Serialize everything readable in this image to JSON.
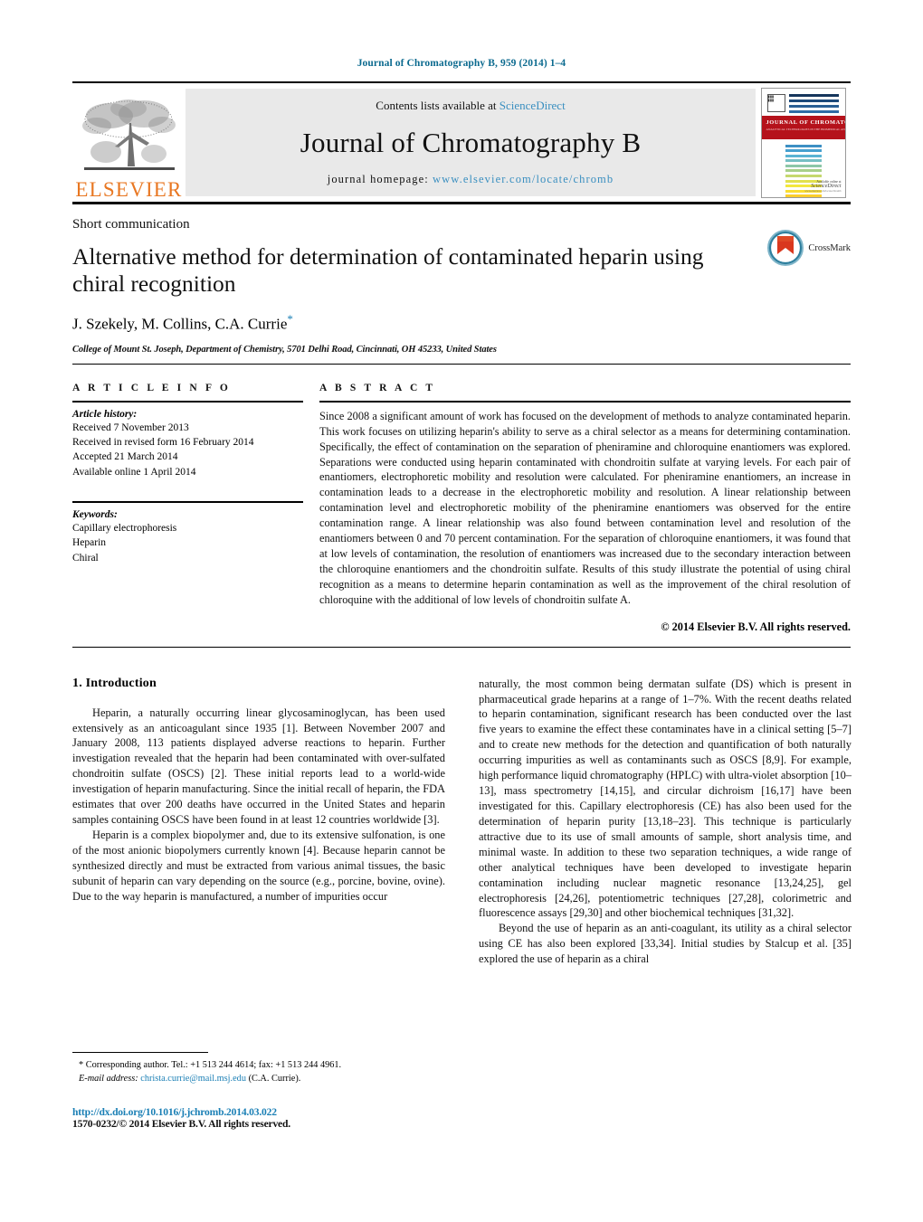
{
  "running_head": "Journal of Chromatography B, 959 (2014) 1–4",
  "masthead": {
    "publisher_name": "ELSEVIER",
    "contents_prefix": "Contents lists available at ",
    "contents_link": "ScienceDirect",
    "journal_title": "Journal of Chromatography B",
    "homepage_prefix": "journal homepage: ",
    "homepage_url": "www.elsevier.com/locate/chromb",
    "cover": {
      "banner_title": "JOURNAL OF CHROMATOGRAPHY B",
      "banner_sub": "ANALYTICAL TECHNOLOGIES IN THE BIOMEDICAL AND LIFE SCIENCES",
      "foot_small": "Available online at",
      "foot_brand": "ScienceDirect",
      "foot_url": "www.elsevier.com/locate/chromb"
    }
  },
  "article": {
    "doctype": "Short communication",
    "title": "Alternative method for determination of contaminated heparin using chiral recognition",
    "authors": "J. Szekely, M. Collins, C.A. Currie",
    "author_star": "*",
    "affiliation": "College of Mount St. Joseph, Department of Chemistry, 5701 Delhi Road, Cincinnati, OH 45233, United States",
    "crossmark_label": "CrossMark"
  },
  "article_info": {
    "section_label": "A R T I C L E   I N F O",
    "history_title": "Article history:",
    "history": [
      "Received 7 November 2013",
      "Received in revised form 16 February 2014",
      "Accepted 21 March 2014",
      "Available online 1 April 2014"
    ],
    "keywords_title": "Keywords:",
    "keywords": [
      "Capillary electrophoresis",
      "Heparin",
      "Chiral"
    ]
  },
  "abstract": {
    "section_label": "A B S T R A C T",
    "text": "Since 2008 a significant amount of work has focused on the development of methods to analyze contaminated heparin. This work focuses on utilizing heparin's ability to serve as a chiral selector as a means for determining contamination. Specifically, the effect of contamination on the separation of pheniramine and chloroquine enantiomers was explored. Separations were conducted using heparin contaminated with chondroitin sulfate at varying levels. For each pair of enantiomers, electrophoretic mobility and resolution were calculated. For pheniramine enantiomers, an increase in contamination leads to a decrease in the electrophoretic mobility and resolution. A linear relationship between contamination level and electrophoretic mobility of the pheniramine enantiomers was observed for the entire contamination range. A linear relationship was also found between contamination level and resolution of the enantiomers between 0 and 70 percent contamination. For the separation of chloroquine enantiomers, it was found that at low levels of contamination, the resolution of enantiomers was increased due to the secondary interaction between the chloroquine enantiomers and the chondroitin sulfate. Results of this study illustrate the potential of using chiral recognition as a means to determine heparin contamination as well as the improvement of the chiral resolution of chloroquine with the additional of low levels of chondroitin sulfate A.",
    "copyright": "© 2014 Elsevier B.V. All rights reserved."
  },
  "body": {
    "section_heading": "1.  Introduction",
    "left_paragraphs": [
      "Heparin, a naturally occurring linear glycosaminoglycan, has been used extensively as an anticoagulant since 1935 [1]. Between November 2007 and January 2008, 113 patients displayed adverse reactions to heparin. Further investigation revealed that the heparin had been contaminated with over-sulfated chondroitin sulfate (OSCS) [2]. These initial reports lead to a world-wide investigation of heparin manufacturing. Since the initial recall of heparin, the FDA estimates that over 200 deaths have occurred in the United States and heparin samples containing OSCS have been found in at least 12 countries worldwide [3].",
      "Heparin is a complex biopolymer and, due to its extensive sulfonation, is one of the most anionic biopolymers currently known [4]. Because heparin cannot be synthesized directly and must be extracted from various animal tissues, the basic subunit of heparin can vary depending on the source (e.g., porcine, bovine, ovine). Due to the way heparin is manufactured, a number of impurities occur"
    ],
    "right_paragraphs": [
      "naturally, the most common being dermatan sulfate (DS) which is present in pharmaceutical grade heparins at a range of 1–7%. With the recent deaths related to heparin contamination, significant research has been conducted over the last five years to examine the effect these contaminates have in a clinical setting [5–7] and to create new methods for the detection and quantification of both naturally occurring impurities as well as contaminants such as OSCS [8,9]. For example, high performance liquid chromatography (HPLC) with ultra-violet absorption [10–13], mass spectrometry [14,15], and circular dichroism [16,17] have been investigated for this. Capillary electrophoresis (CE) has also been used for the determination of heparin purity [13,18–23]. This technique is particularly attractive due to its use of small amounts of sample, short analysis time, and minimal waste. In addition to these two separation techniques, a wide range of other analytical techniques have been developed to investigate heparin contamination including nuclear magnetic resonance [13,24,25], gel electrophoresis [24,26], potentiometric techniques [27,28], colorimetric and fluorescence assays [29,30] and other biochemical techniques [31,32].",
      "Beyond the use of heparin as an anti-coagulant, its utility as a chiral selector using CE has also been explored [33,34]. Initial studies by Stalcup et al. [35] explored the use of heparin as a chiral"
    ]
  },
  "footnote": {
    "corresponding": "*  Corresponding author. Tel.: +1 513 244 4614; fax: +1 513 244 4961.",
    "email_label": "E-mail address:",
    "email": "christa.currie@mail.msj.edu",
    "email_suffix": "(C.A. Currie).",
    "doi": "http://dx.doi.org/10.1016/j.jchromb.2014.03.022",
    "issn": "1570-0232/© 2014 Elsevier B.V. All rights reserved."
  },
  "colors": {
    "link": "#1a7fb5",
    "running_head": "#0b6a8f",
    "elsevier_orange": "#E87722",
    "cover_red": "#b5121b"
  }
}
